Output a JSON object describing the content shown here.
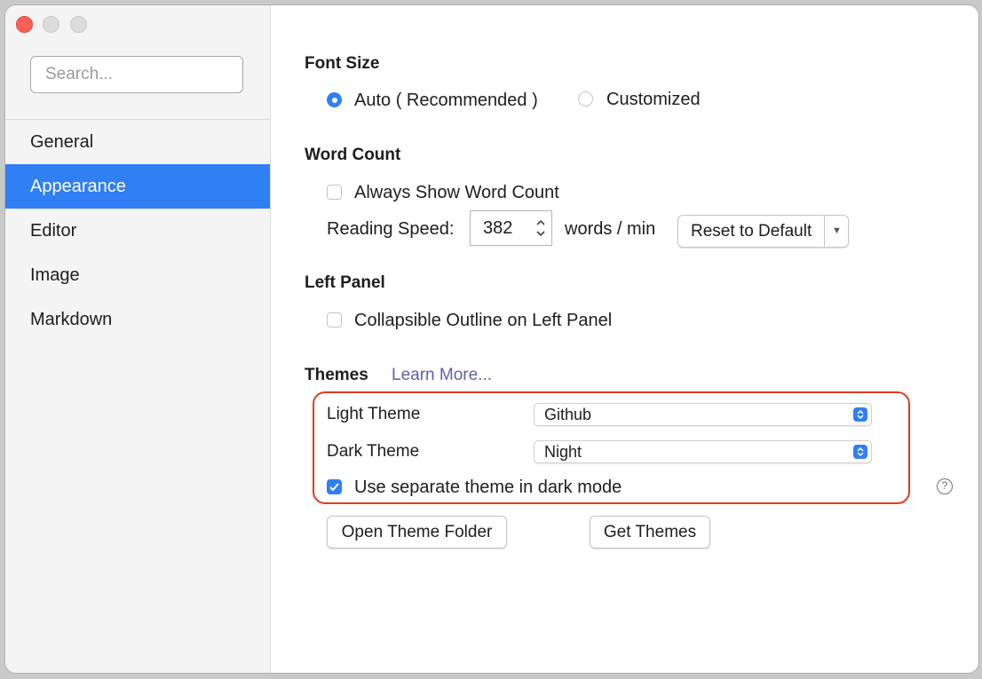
{
  "sidebar": {
    "search_placeholder": "Search...",
    "items": [
      {
        "label": "General",
        "active": false
      },
      {
        "label": "Appearance",
        "active": true
      },
      {
        "label": "Editor",
        "active": false
      },
      {
        "label": "Image",
        "active": false
      },
      {
        "label": "Markdown",
        "active": false
      }
    ]
  },
  "font_size": {
    "title": "Font Size",
    "auto_label": "Auto ( Recommended )",
    "customized_label": "Customized",
    "selected": "auto"
  },
  "word_count": {
    "title": "Word Count",
    "always_show_label": "Always Show Word Count",
    "always_show_checked": false,
    "reading_speed_label": "Reading Speed:",
    "reading_speed_value": "382",
    "unit_label": "words / min",
    "reset_button": "Reset to Default"
  },
  "left_panel": {
    "title": "Left Panel",
    "collapsible_label": "Collapsible Outline on Left Panel",
    "collapsible_checked": false
  },
  "themes": {
    "title": "Themes",
    "learn_more": "Learn More...",
    "light_label": "Light Theme",
    "light_value": "Github",
    "dark_label": "Dark Theme",
    "dark_value": "Night",
    "separate_label": "Use separate theme in dark mode",
    "separate_checked": true,
    "open_folder_button": "Open Theme Folder",
    "get_themes_button": "Get Themes",
    "help_icon": "?"
  },
  "colors": {
    "accent": "#2f7ff5",
    "highlight_border": "#e23a1e",
    "link": "#5a62a8"
  }
}
